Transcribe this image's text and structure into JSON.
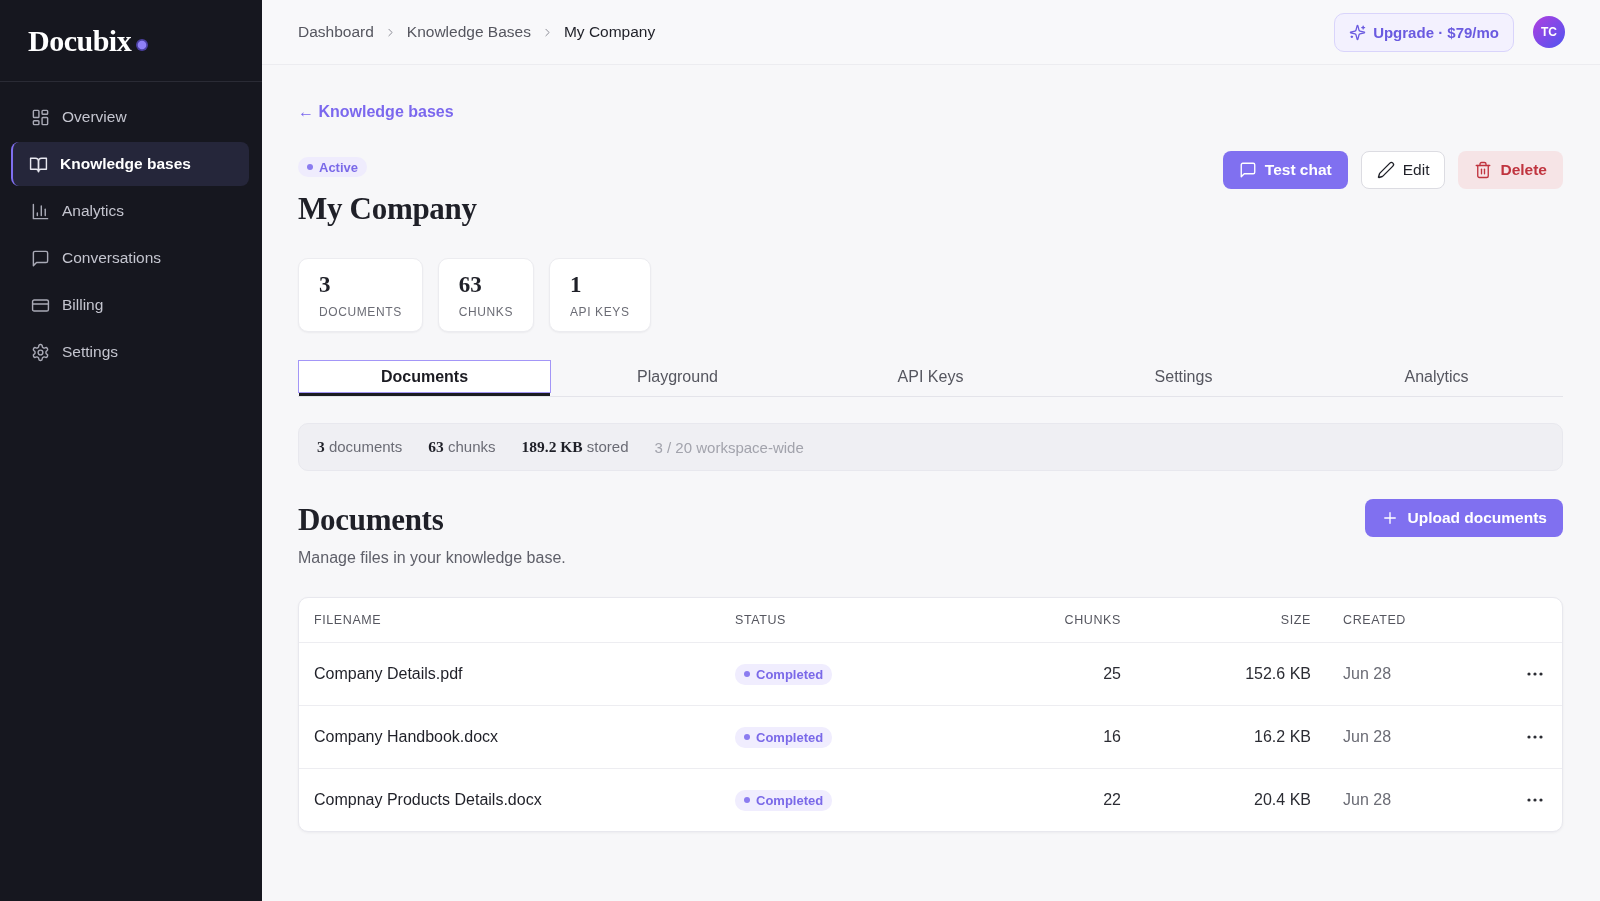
{
  "sidebar": {
    "logo": "Docubix",
    "items": [
      {
        "label": "Overview",
        "selected": false
      },
      {
        "label": "Knowledge bases",
        "selected": true
      },
      {
        "label": "Analytics",
        "selected": false
      },
      {
        "label": "Conversations",
        "selected": false
      },
      {
        "label": "Billing",
        "selected": false
      },
      {
        "label": "Settings",
        "selected": false
      }
    ]
  },
  "topbar": {
    "breadcrumb": [
      {
        "label": "Dashboard",
        "current": false
      },
      {
        "label": "Knowledge Bases",
        "current": false
      },
      {
        "label": "My Company",
        "current": true
      }
    ],
    "upgrade_button": "Upgrade · $79/mo",
    "avatar": "TC"
  },
  "header": {
    "back_link": "← Knowledge bases",
    "status": "Active",
    "title": "My Company",
    "actions": [
      {
        "label": "Test chat",
        "kind": "primary"
      },
      {
        "label": "Edit",
        "kind": "secondary"
      },
      {
        "label": "Delete",
        "kind": "danger"
      }
    ]
  },
  "stats": [
    {
      "value": "3",
      "label": "DOCUMENTS"
    },
    {
      "value": "63",
      "label": "CHUNKS"
    },
    {
      "value": "1",
      "label": "API KEYS"
    }
  ],
  "tabs": [
    {
      "label": "Documents",
      "selected": true
    },
    {
      "label": "Playground",
      "selected": false
    },
    {
      "label": "API Keys",
      "selected": false
    },
    {
      "label": "Settings",
      "selected": false
    },
    {
      "label": "Analytics",
      "selected": false
    }
  ],
  "summary": [
    {
      "text": "**3** documents",
      "kind": "count"
    },
    {
      "text": "**63** chunks",
      "kind": "count"
    },
    {
      "text": "**189.2 KB** stored",
      "kind": "count"
    },
    {
      "text": "3 / 20 workspace-wide",
      "kind": "quota"
    }
  ],
  "documents": {
    "title": "Documents",
    "subtitle": "Manage files in your knowledge base.",
    "upload_button": "Upload documents",
    "table": {
      "columns": [
        "FILENAME",
        "STATUS",
        "CHUNKS",
        "SIZE",
        "CREATED"
      ],
      "rows": [
        {
          "filename": "Company Details.pdf",
          "status": "Completed",
          "chunks": "25",
          "size": "152.6 KB",
          "created": "Jun 28"
        },
        {
          "filename": "Company Handbook.docx",
          "status": "Completed",
          "chunks": "16",
          "size": "16.2 KB",
          "created": "Jun 28"
        },
        {
          "filename": "Compnay Products Details.docx",
          "status": "Completed",
          "chunks": "22",
          "size": "20.4 KB",
          "created": "Jun 28"
        }
      ]
    }
  }
}
